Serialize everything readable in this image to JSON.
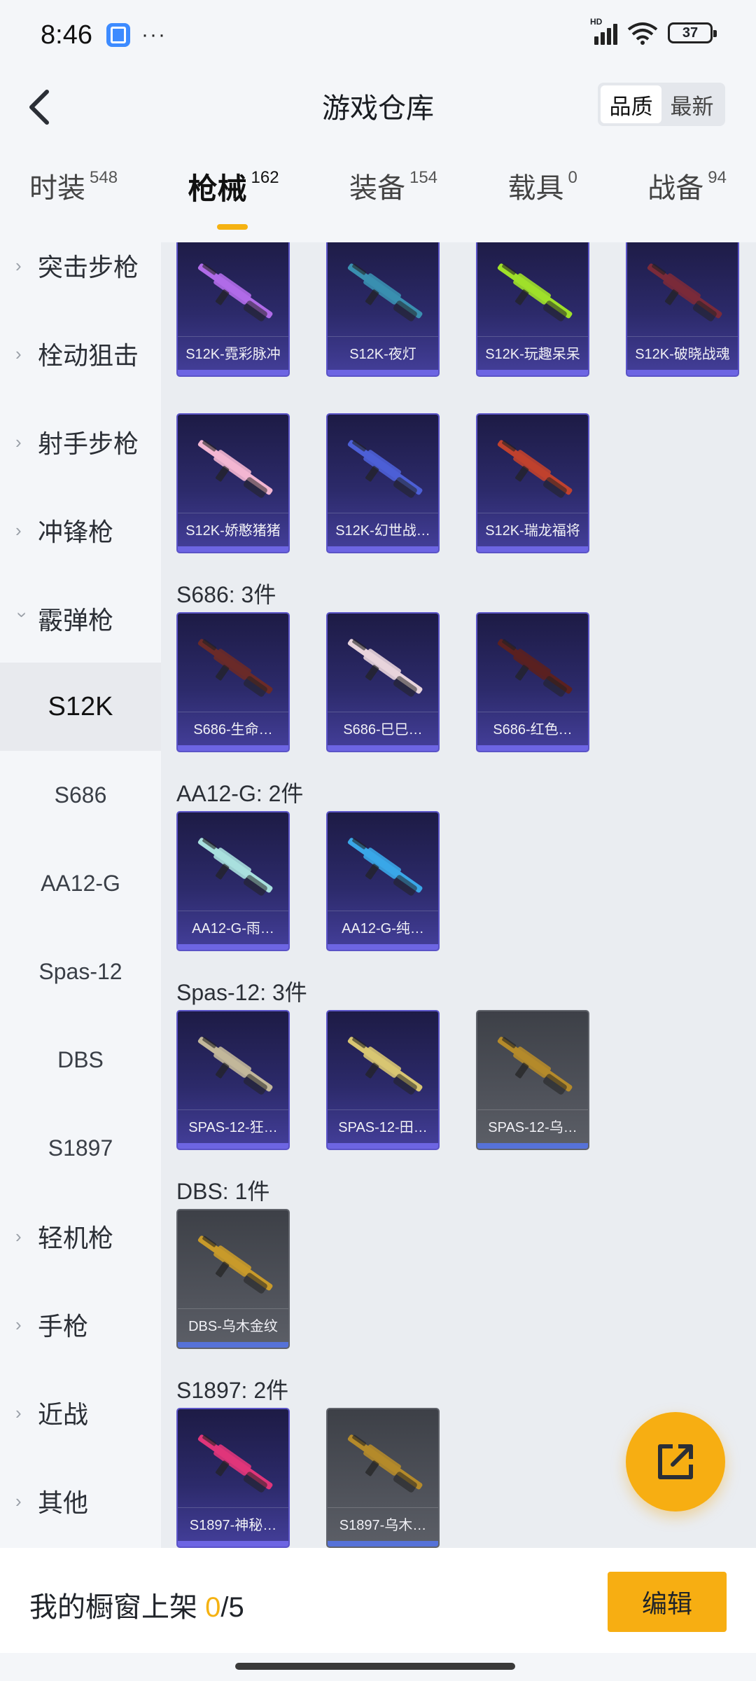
{
  "status_bar": {
    "time": "8:46",
    "dots": "···",
    "hd": "HD",
    "battery": "37"
  },
  "header": {
    "title": "游戏仓库",
    "sort_options": [
      "品质",
      "最新"
    ],
    "active_sort": "品质"
  },
  "tabs": [
    {
      "label": "时装",
      "count": "548"
    },
    {
      "label": "枪械",
      "count": "162",
      "active": true
    },
    {
      "label": "装备",
      "count": "154"
    },
    {
      "label": "载具",
      "count": "0"
    },
    {
      "label": "战备",
      "count": "94"
    }
  ],
  "sidebar": {
    "categories": [
      {
        "label": "突击步枪"
      },
      {
        "label": "栓动狙击"
      },
      {
        "label": "射手步枪"
      },
      {
        "label": "冲锋枪"
      },
      {
        "label": "霰弹枪",
        "expanded": true
      }
    ],
    "subcategories": [
      "S12K",
      "S686",
      "AA12-G",
      "Spas-12",
      "DBS",
      "S1897"
    ],
    "active_sub": "S12K",
    "more_categories": [
      {
        "label": "轻机枪"
      },
      {
        "label": "手枪"
      },
      {
        "label": "近战"
      },
      {
        "label": "其他"
      }
    ]
  },
  "sections": [
    {
      "label": "",
      "items": [
        {
          "name": "S12K-霓彩脉冲",
          "rarity": "purple",
          "gun_color": "#b06be8"
        },
        {
          "name": "S12K-夜灯",
          "rarity": "purple",
          "gun_color": "#3a8fb0"
        },
        {
          "name": "S12K-玩趣呆呆",
          "rarity": "purple",
          "gun_color": "#9fe02a"
        },
        {
          "name": "S12K-破晓战魂",
          "rarity": "purple",
          "gun_color": "#7a2a3a"
        },
        {
          "name": "S12K-娇憨猪猪",
          "rarity": "purple",
          "gun_color": "#f3b6d2"
        },
        {
          "name": "S12K-幻世战…",
          "rarity": "purple",
          "gun_color": "#4c5fd6"
        },
        {
          "name": "S12K-瑞龙福将",
          "rarity": "purple",
          "gun_color": "#c0412e"
        }
      ]
    },
    {
      "label": "S686: 3件",
      "items": [
        {
          "name": "S686-生命…",
          "rarity": "purple",
          "gun_color": "#6a2a28"
        },
        {
          "name": "S686-巳巳…",
          "rarity": "purple",
          "gun_color": "#e8d4dc"
        },
        {
          "name": "S686-红色…",
          "rarity": "purple",
          "gun_color": "#5a2020"
        }
      ]
    },
    {
      "label": "AA12-G: 2件",
      "items": [
        {
          "name": "AA12-G-雨…",
          "rarity": "purple",
          "gun_color": "#a8e0de"
        },
        {
          "name": "AA12-G-纯…",
          "rarity": "purple",
          "gun_color": "#3aa7e8"
        }
      ]
    },
    {
      "label": "Spas-12: 3件",
      "items": [
        {
          "name": "SPAS-12-狂…",
          "rarity": "purple",
          "gun_color": "#c2b79a"
        },
        {
          "name": "SPAS-12-田…",
          "rarity": "purple",
          "gun_color": "#d8c572"
        },
        {
          "name": "SPAS-12-乌…",
          "rarity": "gray",
          "gun_color": "#b48a2a"
        }
      ]
    },
    {
      "label": "DBS: 1件",
      "items": [
        {
          "name": "DBS-乌木金纹",
          "rarity": "gray",
          "gun_color": "#c89a2a"
        }
      ]
    },
    {
      "label": "S1897: 2件",
      "items": [
        {
          "name": "S1897-神秘…",
          "rarity": "purple",
          "gun_color": "#e0357a"
        },
        {
          "name": "S1897-乌木…",
          "rarity": "gray",
          "gun_color": "#b48a2a"
        }
      ]
    }
  ],
  "bottom_bar": {
    "showcase_label": "我的橱窗上架 ",
    "current": "0",
    "total": "/5",
    "edit_label": "编辑"
  },
  "colors": {
    "accent": "#f7ae12",
    "card_purple": "#2c2a6a",
    "card_gray": "#4f525a"
  }
}
